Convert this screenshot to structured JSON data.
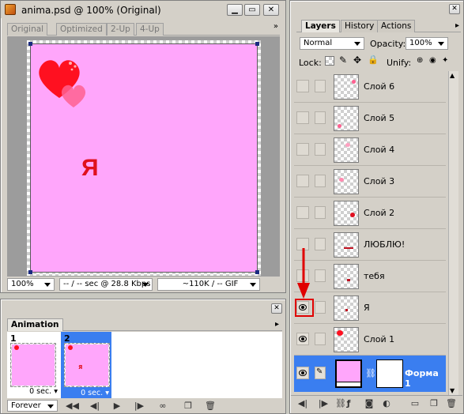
{
  "document": {
    "title": "anima.psd @ 100% (Original)",
    "tabs": [
      {
        "label": "Original",
        "active": true
      },
      {
        "label": "Optimized",
        "active": false
      },
      {
        "label": "2-Up",
        "active": false
      },
      {
        "label": "4-Up",
        "active": false
      }
    ],
    "canvas_text": "Я",
    "zoom": "100%",
    "download_time": "-- / -- sec @ 28.8 Kbps",
    "file_info": "~110K / -- GIF",
    "canvas_color": "#ffa6fb"
  },
  "animation": {
    "tab": "Animation",
    "frames": [
      {
        "number": "1",
        "delay": "0 sec.",
        "selected": false,
        "text": ""
      },
      {
        "number": "2",
        "delay": "0 sec.",
        "selected": true,
        "text": "Я"
      }
    ],
    "loop": "Forever"
  },
  "layers_panel": {
    "tabs": [
      {
        "label": "Layers",
        "active": true
      },
      {
        "label": "History",
        "active": false
      },
      {
        "label": "Actions",
        "active": false
      }
    ],
    "blend_mode": "Normal",
    "opacity_label": "Opacity:",
    "opacity": "100%",
    "lock_label": "Lock:",
    "unify_label": "Unify:",
    "layers": [
      {
        "name": "Слой 6",
        "visible": false,
        "selected": false
      },
      {
        "name": "Слой 5",
        "visible": false,
        "selected": false
      },
      {
        "name": "Слой 4",
        "visible": false,
        "selected": false
      },
      {
        "name": "Слой 3",
        "visible": false,
        "selected": false
      },
      {
        "name": "Слой 2",
        "visible": false,
        "selected": false
      },
      {
        "name": "ЛЮБЛЮ!",
        "visible": false,
        "selected": false
      },
      {
        "name": "тебя",
        "visible": false,
        "selected": false
      },
      {
        "name": "Я",
        "visible": true,
        "selected": false,
        "highlight": true
      },
      {
        "name": "Слой 1",
        "visible": true,
        "selected": false
      },
      {
        "name": "Форма 1",
        "visible": true,
        "selected": true
      }
    ]
  },
  "colors": {
    "selection": "#3a7ef0",
    "highlight_box": "#e00000",
    "arrow": "#e00000"
  }
}
